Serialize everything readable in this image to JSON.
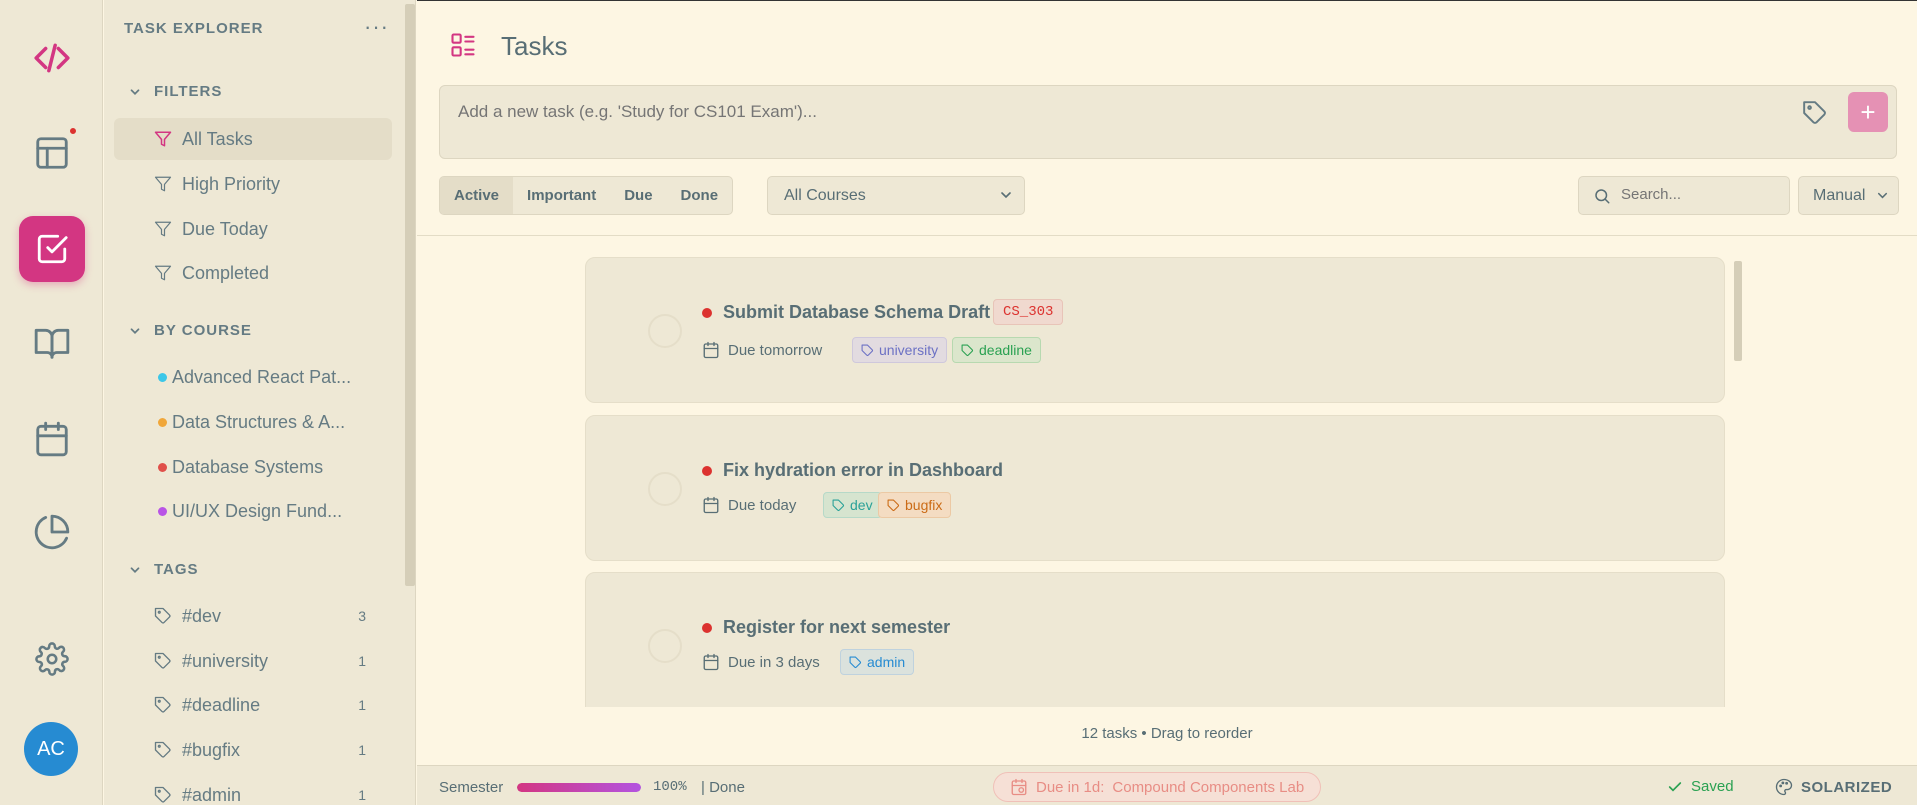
{
  "activity": {
    "avatar_initials": "AC",
    "notification": true
  },
  "sidebar": {
    "title": "TASK EXPLORER",
    "more": "···",
    "filters_heading": "FILTERS",
    "filters": [
      {
        "label": "All Tasks",
        "active": true
      },
      {
        "label": "High Priority"
      },
      {
        "label": "Due Today"
      },
      {
        "label": "Completed"
      }
    ],
    "courses_heading": "BY COURSE",
    "courses": [
      {
        "label": "Advanced React Pat...",
        "color": "#3cc7e8"
      },
      {
        "label": "Data Structures & A...",
        "color": "#f0a73a"
      },
      {
        "label": "Database Systems",
        "color": "#e0504a"
      },
      {
        "label": "UI/UX Design Fund...",
        "color": "#b954e6"
      }
    ],
    "tags_heading": "TAGS",
    "tags": [
      {
        "label": "#dev",
        "count": "3"
      },
      {
        "label": "#university",
        "count": "1"
      },
      {
        "label": "#deadline",
        "count": "1"
      },
      {
        "label": "#bugfix",
        "count": "1"
      },
      {
        "label": "#admin",
        "count": "1"
      }
    ]
  },
  "main": {
    "title": "Tasks",
    "add_placeholder": "Add a new task (e.g. 'Study for CS101 Exam')...",
    "add_button": "+",
    "segments": [
      "Active",
      "Important",
      "Due",
      "Done"
    ],
    "active_segment": "Active",
    "course_select": "All Courses",
    "search_placeholder": "Search...",
    "sort": "Manual",
    "tasks": [
      {
        "title": "Submit Database Schema Draft",
        "code": "CS_303",
        "due": "Due tomorrow",
        "tags": [
          {
            "label": "university",
            "color": "#6c71c4",
            "bg": "#e2dbe0",
            "border": "#cfc8dc"
          },
          {
            "label": "deadline",
            "color": "#2aa152",
            "bg": "#dbe6cc",
            "border": "#b7d9b0"
          }
        ]
      },
      {
        "title": "Fix hydration error in Dashboard",
        "code": "",
        "due": "Due today",
        "tags": [
          {
            "label": "dev",
            "color": "#2aa198",
            "bg": "#d6e4cf",
            "border": "#b6d9c8"
          },
          {
            "label": "bugfix",
            "color": "#cb6b16",
            "bg": "#f4dcc2",
            "border": "#ecc9a4"
          }
        ]
      },
      {
        "title": "Register for next semester",
        "code": "",
        "due": "Due in 3 days",
        "tags": [
          {
            "label": "admin",
            "color": "#268bd2",
            "bg": "#dbe2dd",
            "border": "#bfd2de"
          }
        ]
      }
    ],
    "footer": "12 tasks • Drag to reorder"
  },
  "status": {
    "semester_label": "Semester",
    "progress_percent": 100,
    "progress_text": "100%",
    "done_text": "| Done",
    "due_label": "Due in 1d:",
    "due_task": "Compound Components Lab",
    "saved": "Saved",
    "theme": "SOLARIZED"
  },
  "colors": {
    "accent": "#d33682",
    "background": "#fdf6e3",
    "panel": "#eee8d5",
    "text": "#586e75",
    "priority": "#dc322f"
  }
}
